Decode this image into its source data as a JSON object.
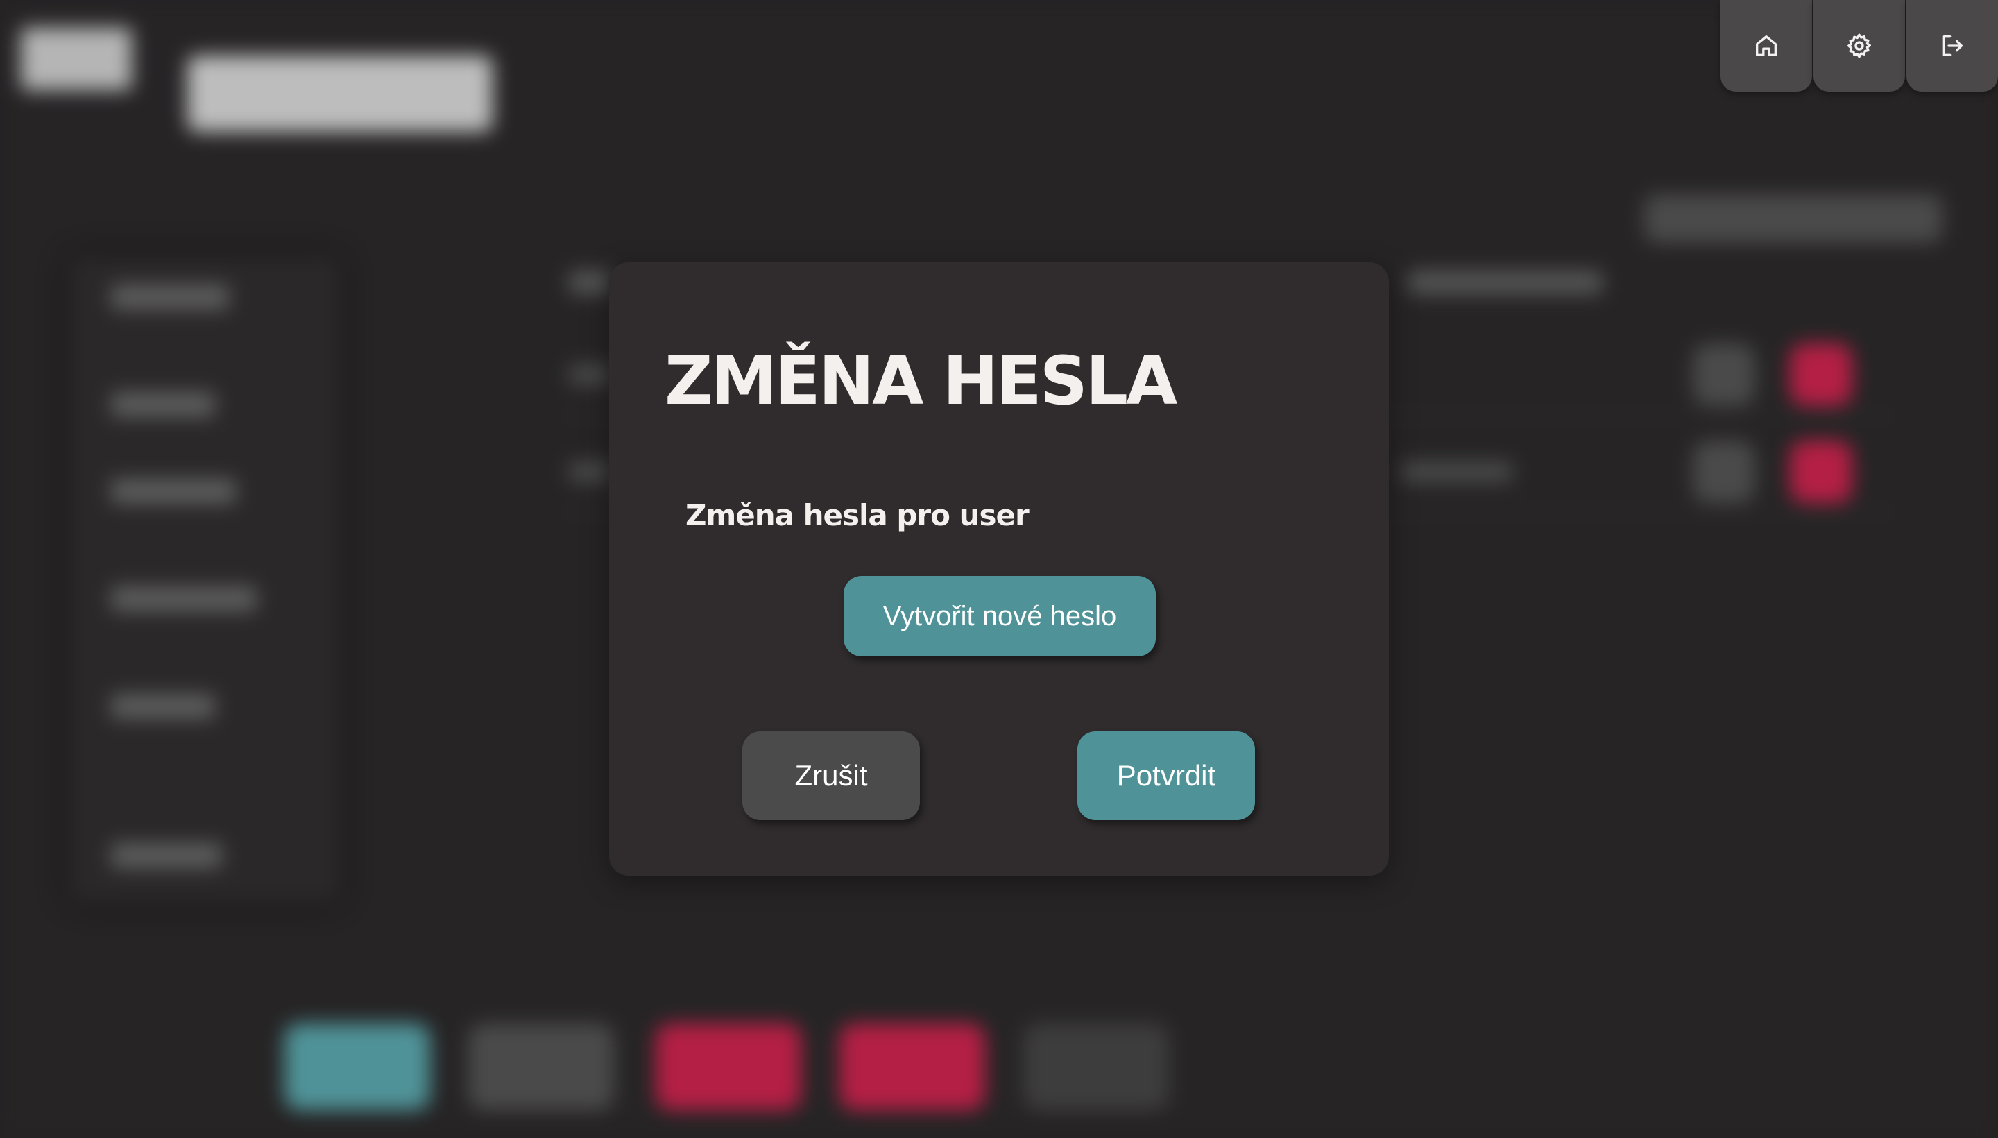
{
  "colors": {
    "page_bg": "#242223",
    "modal_bg": "#302c2d",
    "primary_teal": "#4f9398",
    "secondary_gray": "#4c4b4b",
    "danger_red": "#b41f45",
    "text_light": "#f4f0ee"
  },
  "toolbar": {
    "items": [
      {
        "icon": "home-icon"
      },
      {
        "icon": "gear-icon"
      },
      {
        "icon": "logout-icon"
      }
    ]
  },
  "modal": {
    "title": "ZMĚNA HESLA",
    "subtitle": "Změna hesla pro user",
    "generate_button_label": "Vytvořit nové heslo",
    "cancel_button_label": "Zrušit",
    "confirm_button_label": "Potvrdit"
  }
}
